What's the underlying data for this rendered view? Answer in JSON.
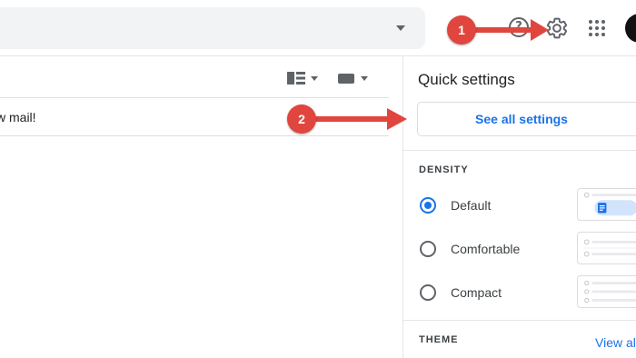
{
  "toolbar": {
    "help_icon_glyph": "?",
    "icons": [
      "search-caret",
      "help-icon",
      "gear-icon",
      "apps-icon",
      "avatar"
    ]
  },
  "mail": {
    "row_text": "w mail!"
  },
  "quick_settings": {
    "title": "Quick settings",
    "see_all_label": "See all settings",
    "density_label": "DENSITY",
    "density_options": [
      {
        "label": "Default",
        "selected": true
      },
      {
        "label": "Comfortable",
        "selected": false
      },
      {
        "label": "Compact",
        "selected": false
      }
    ],
    "theme_label": "THEME",
    "view_all_label": "View al"
  },
  "callouts": [
    {
      "label": "1"
    },
    {
      "label": "2"
    }
  ],
  "colors": {
    "accent": "#1a73e8",
    "callout": "#e0463e",
    "search_bg": "#f1f3f4"
  }
}
